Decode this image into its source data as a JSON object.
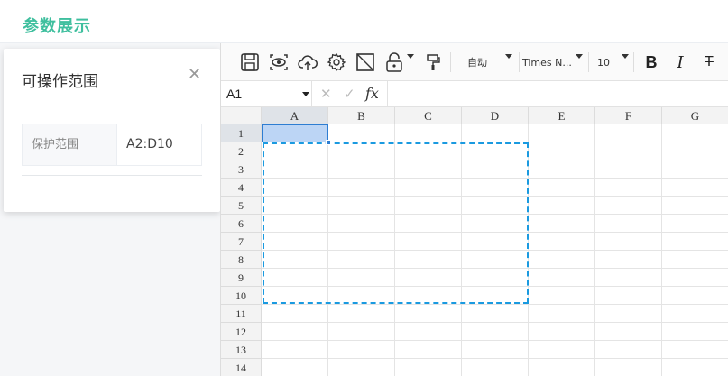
{
  "header": {
    "title": "参数展示"
  },
  "panel": {
    "title": "可操作范围",
    "close_icon": "close-icon",
    "range_label": "保护范围",
    "range_value": "A2:D10"
  },
  "toolbar": {
    "icons": [
      "save-icon",
      "preview-icon",
      "upload-icon",
      "settings-icon",
      "border-icon",
      "lock-icon",
      "format-painter-icon"
    ],
    "zoom_label": "自动",
    "font_name": "Times N...",
    "font_size": "10",
    "bold_label": "B",
    "italic_label": "I",
    "strike_label": "T"
  },
  "formula_bar": {
    "cell_ref": "A1",
    "cancel_label": "✕",
    "confirm_label": "✓",
    "fx_label": "fx"
  },
  "grid": {
    "columns": [
      "A",
      "B",
      "C",
      "D",
      "E",
      "F",
      "G"
    ],
    "rows": [
      "1",
      "2",
      "3",
      "4",
      "5",
      "6",
      "7",
      "8",
      "9",
      "10",
      "11",
      "12",
      "13",
      "14"
    ],
    "active_cell": "A1",
    "protected_range": "A2:D10"
  },
  "colors": {
    "brand": "#3fbf9e",
    "selection_border": "#2d7dd2",
    "protect_border": "#1a9ae0"
  }
}
